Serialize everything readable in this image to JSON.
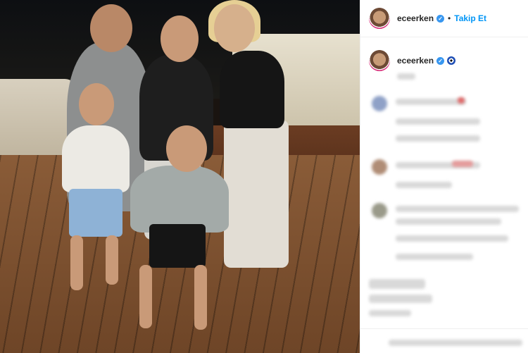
{
  "post": {
    "username": "eceerken",
    "follow_label": "Takip Et",
    "separator": "•",
    "verified_glyph": "✓"
  },
  "caption": {
    "username": "eceerken",
    "emoji": "evil-eye-icon"
  },
  "colors": {
    "follow_blue": "#0095f6",
    "verified_blue": "#3897f0",
    "text": "#262626"
  }
}
